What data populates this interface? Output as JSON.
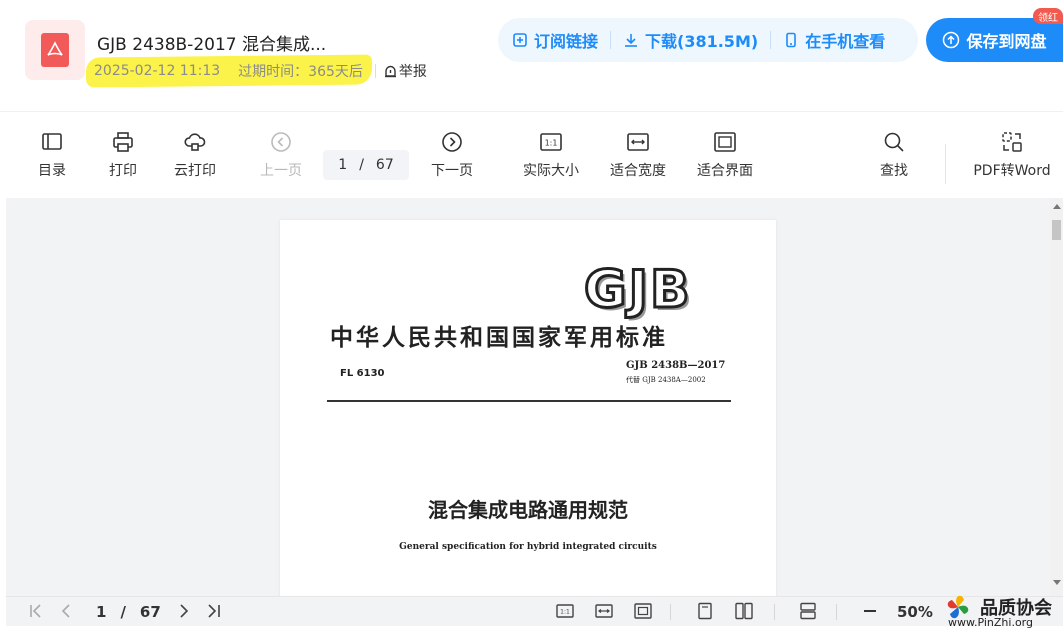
{
  "header": {
    "file_title": "GJB 2438B-2017 混合集成...",
    "date": "2025-02-12 11:13",
    "expire": "过期时间：365天后",
    "report": "举报",
    "subscribe": "订阅链接",
    "download": "下载(381.5M)",
    "mobile": "在手机查看",
    "save": "保存到网盘",
    "red_tag": "领红"
  },
  "toolbar": {
    "toc": "目录",
    "print": "打印",
    "cloud_print": "云打印",
    "prev": "上一页",
    "current_page": "1",
    "page_sep": "/",
    "total_pages": "67",
    "next": "下一页",
    "actual_size": "实际大小",
    "fit_width": "适合宽度",
    "fit_page": "适合界面",
    "search": "查找",
    "pdf_to_word": "PDF转Word"
  },
  "document": {
    "logo": "GJB",
    "standard_title": "中华人民共和国国家军用标准",
    "classification": "FL  6130",
    "code": "GJB  2438B—2017",
    "replaces": "代替 GJB 2438A—2002",
    "cn_name": "混合集成电路通用规范",
    "en_name": "General specification for hybrid integrated circuits"
  },
  "bottom": {
    "current_page": "1",
    "page_sep": "/",
    "total_pages": "67",
    "zoom": "50%"
  },
  "watermark": {
    "title": "品质协会",
    "url": "www.PinZhi.org"
  },
  "colors": {
    "accent": "#1d8cf8",
    "highlight": "#fbf23a",
    "pdf_red": "#f25a5a"
  }
}
